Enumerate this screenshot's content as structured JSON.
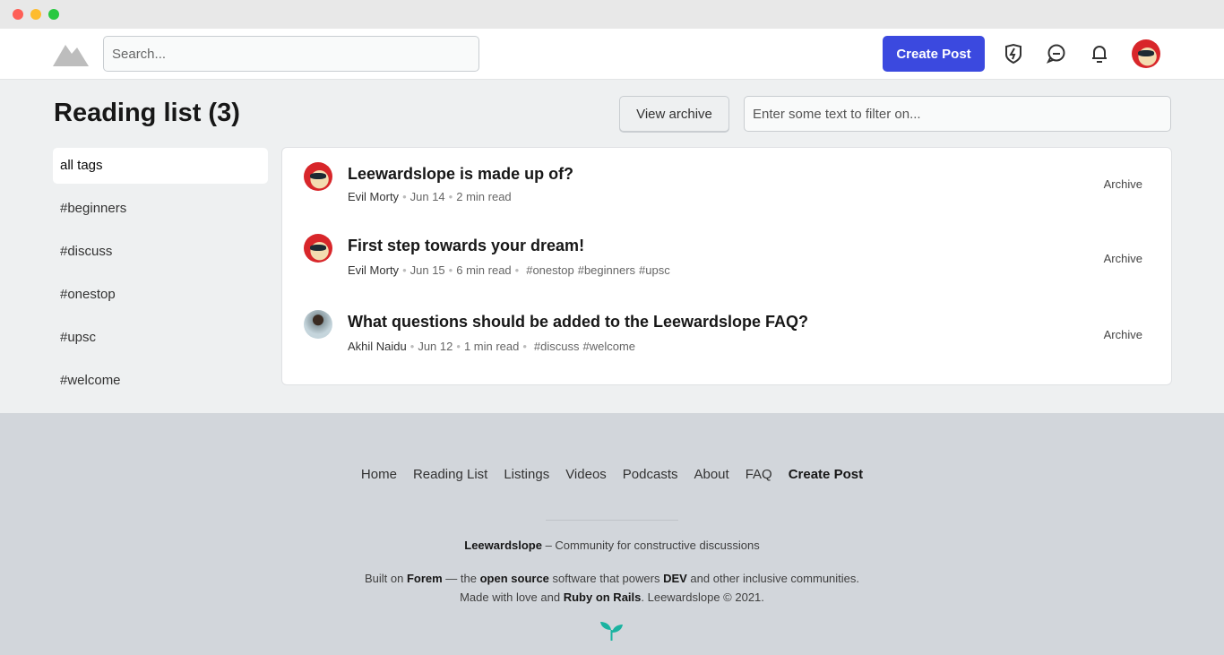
{
  "header": {
    "search_placeholder": "Search...",
    "create_post": "Create Post"
  },
  "page": {
    "title": "Reading list (3)",
    "view_archive": "View archive",
    "filter_placeholder": "Enter some text to filter on..."
  },
  "tags": [
    "all tags",
    "#beginners",
    "#discuss",
    "#onestop",
    "#upsc",
    "#welcome"
  ],
  "items": [
    {
      "title": "Leewardslope is made up of?",
      "author": "Evil Morty",
      "date": "Jun 14",
      "read": "2 min read",
      "tags": [],
      "archive": "Archive"
    },
    {
      "title": "First step towards your dream!",
      "author": "Evil Morty",
      "date": "Jun 15",
      "read": "6 min read",
      "tags": [
        "#onestop",
        "#beginners",
        "#upsc"
      ],
      "archive": "Archive"
    },
    {
      "title": "What questions should be added to the Leewardslope FAQ?",
      "author": "Akhil Naidu",
      "date": "Jun 12",
      "read": "1 min read",
      "tags": [
        "#discuss",
        "#welcome"
      ],
      "archive": "Archive"
    }
  ],
  "footer": {
    "nav": [
      "Home",
      "Reading List",
      "Listings",
      "Videos",
      "Podcasts",
      "About",
      "FAQ",
      "Create Post"
    ],
    "brand": "Leewardslope",
    "tagline": " – Community for constructive discussions",
    "l2a": "Built on ",
    "forem": "Forem",
    "l2b": " — the ",
    "open_source": "open source",
    "l2c": " software that powers ",
    "dev": "DEV",
    "l2d": " and other inclusive communities.",
    "l3a": "Made with love and ",
    "rails": "Ruby on Rails",
    "l3b": ". Leewardslope © 2021."
  },
  "colors": {
    "accent": "#3b49df",
    "footer_bg": "#d2d6db",
    "sprout": "#1ab3a0"
  }
}
